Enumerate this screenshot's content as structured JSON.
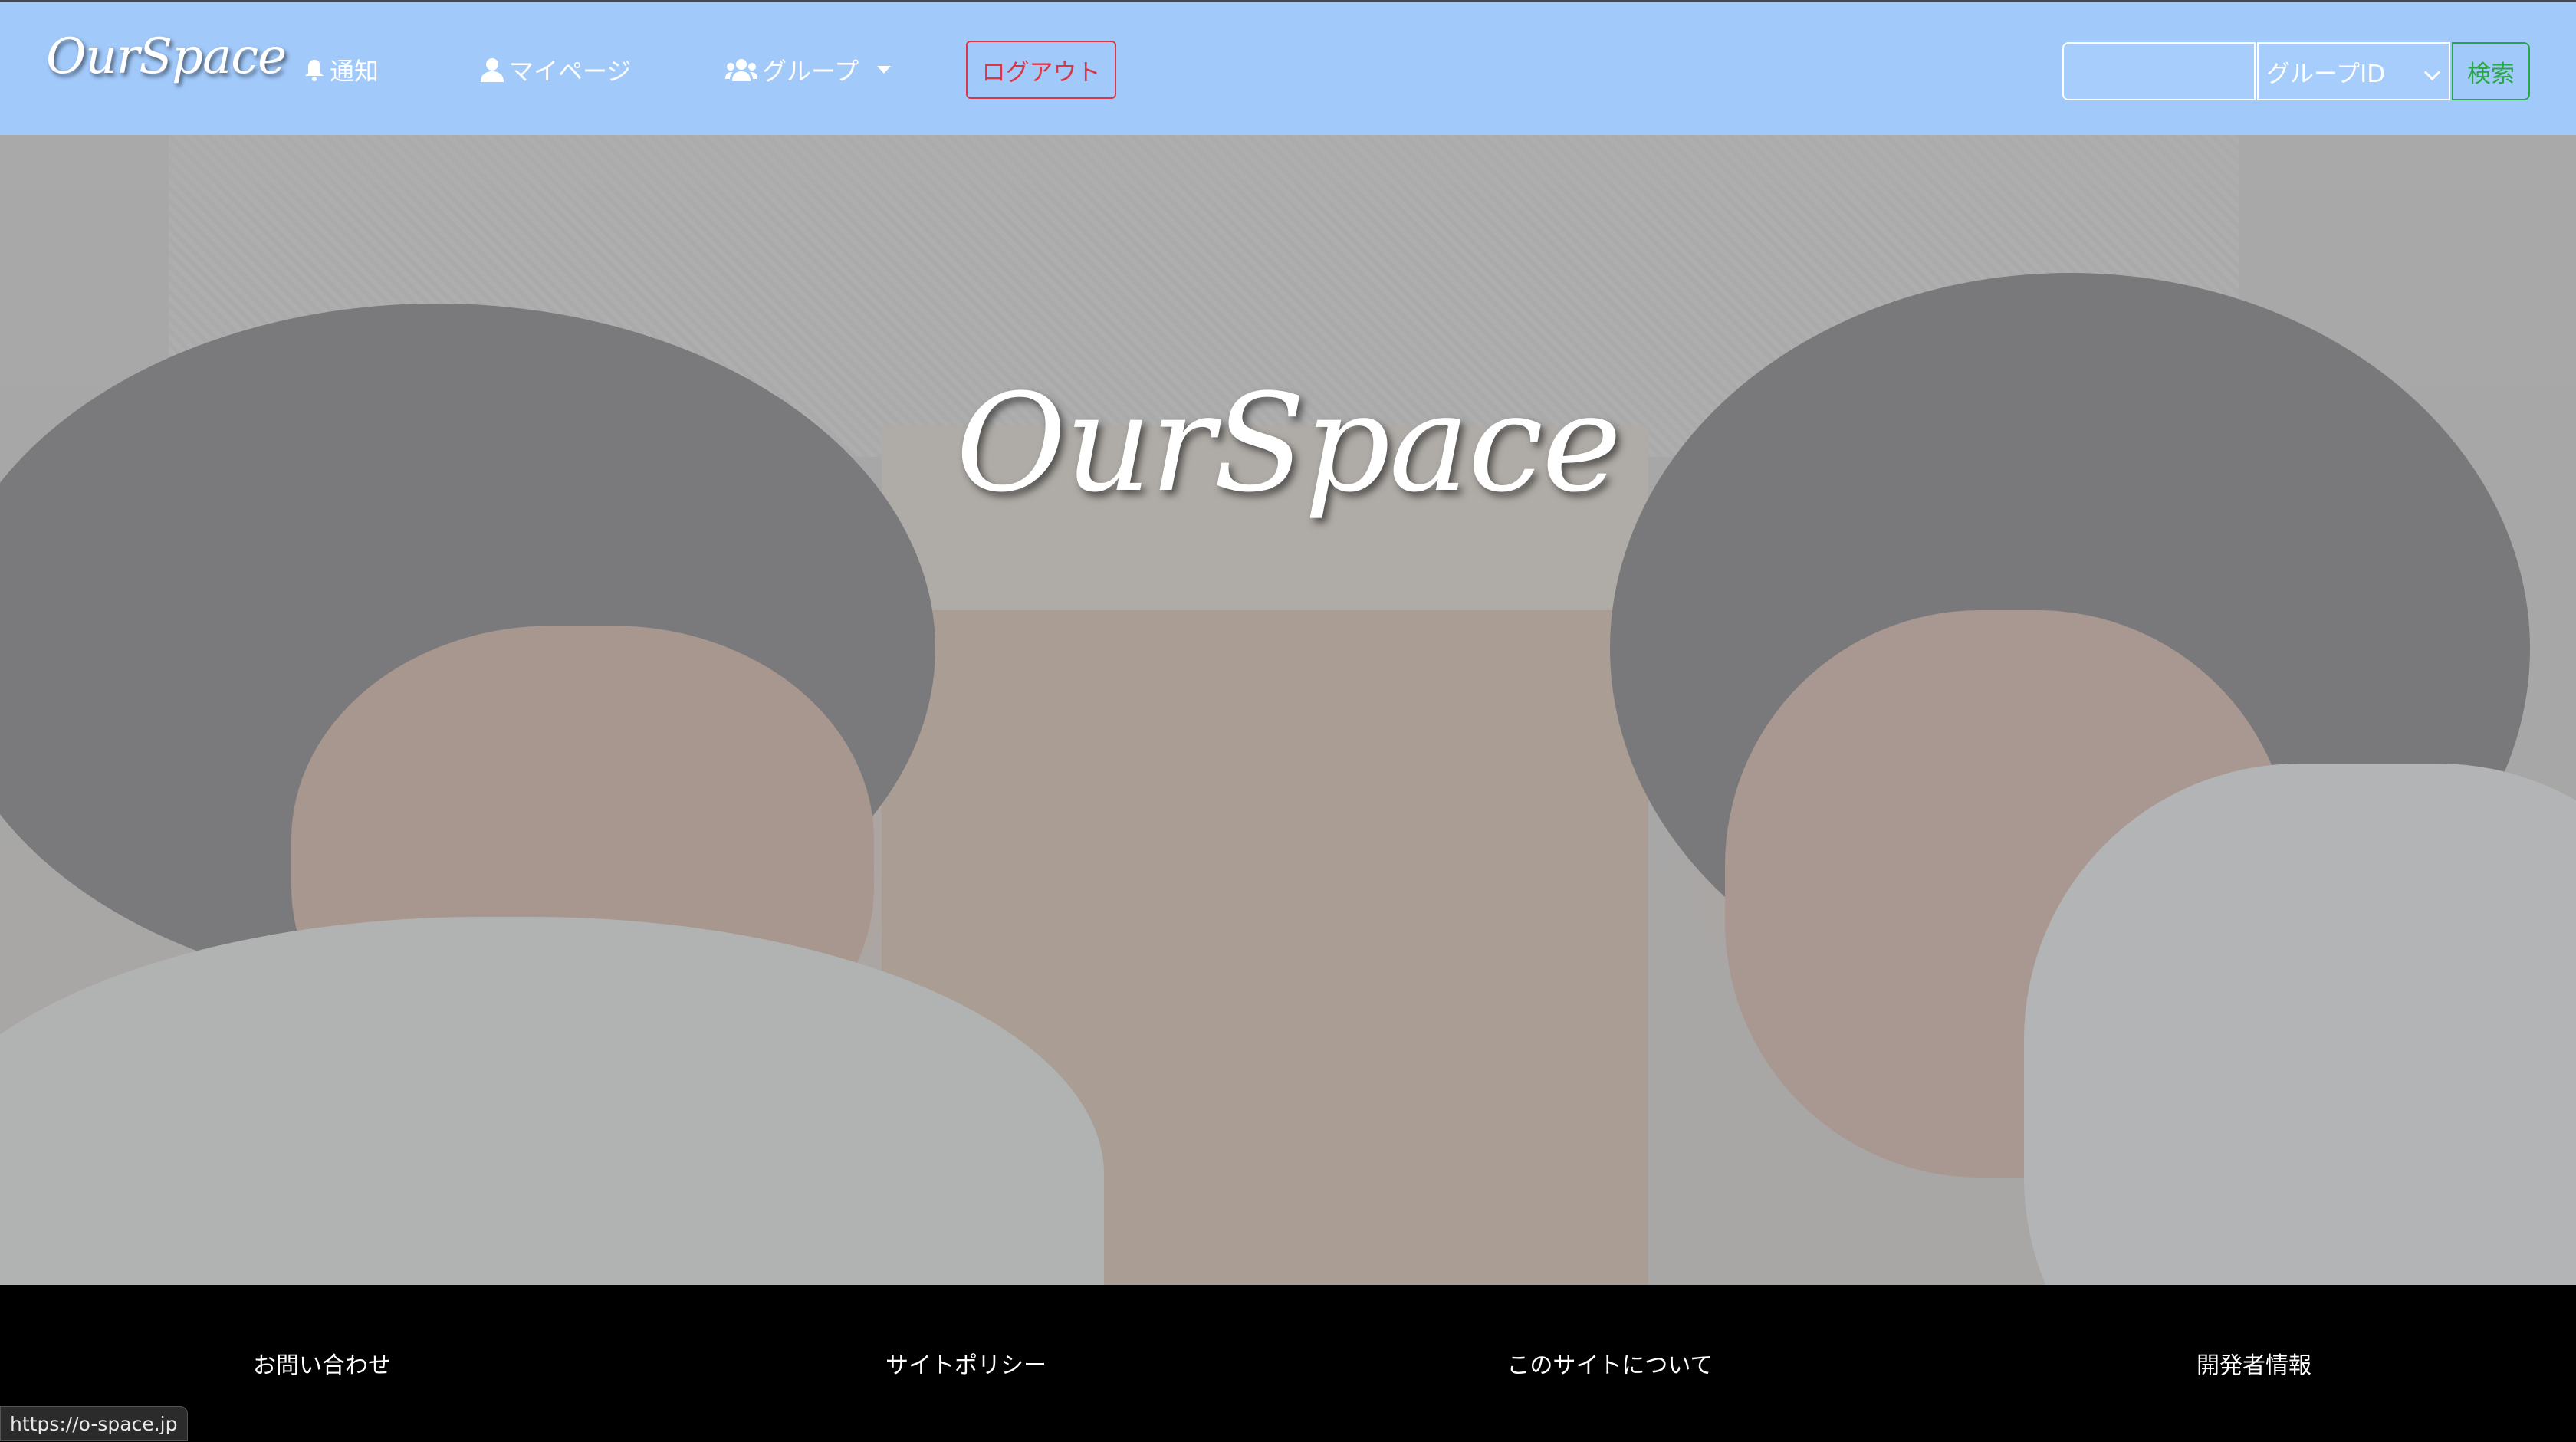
{
  "navbar": {
    "brand": "OurSpace",
    "items": [
      {
        "label": "通知",
        "icon": "bell-icon"
      },
      {
        "label": "マイページ",
        "icon": "user-icon"
      },
      {
        "label": "グループ",
        "icon": "users-icon"
      }
    ],
    "logout_label": "ログアウト",
    "search": {
      "input_value": "",
      "select_value": "グループID",
      "button_label": "検索"
    },
    "colors": {
      "background": "#a1c9fa",
      "logout": "#dc3545",
      "search": "#28a745"
    }
  },
  "hero": {
    "title": "OurSpace"
  },
  "footer": {
    "links": [
      "お問い合わせ",
      "サイトポリシー",
      "このサイトについて",
      "開発者情報"
    ]
  },
  "status_bar": {
    "url": "https://o-space.jp"
  }
}
